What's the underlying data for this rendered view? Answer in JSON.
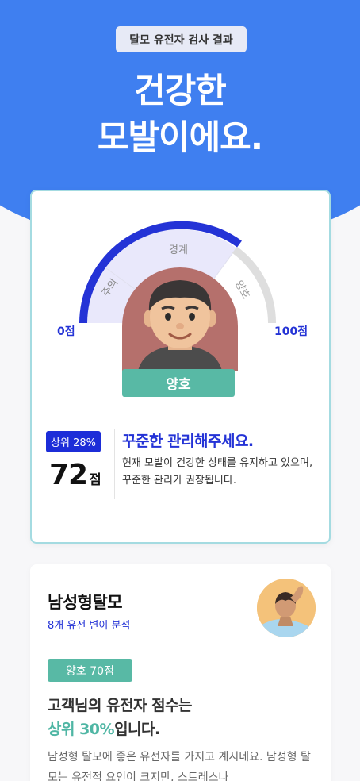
{
  "header": {
    "tag": "탈모 유전자 검사 결과",
    "title_line1": "건강한",
    "title_line2": "모발이에요."
  },
  "gauge": {
    "zones": [
      "주의",
      "경계",
      "양호"
    ],
    "min_label": "0점",
    "max_label": "100점",
    "score": 72,
    "status": "양호",
    "colors": {
      "fill": "#2433d6",
      "track": "#dedede",
      "zone_bg": "#e9e8fb"
    }
  },
  "result": {
    "rank_badge": "상위 28%",
    "score_value": "72",
    "score_unit": "점",
    "advice_title": "꾸준한 관리해주세요.",
    "advice_body": "현재 모발이 건강한 상태를 유지하고 있으며, 꾸준한 관리가 권장됩니다."
  },
  "male_pattern": {
    "title": "남성형탈모",
    "subtitle": "8개 유전 변이 분석",
    "status_pill": "양호 70점",
    "line1": "고객님의 유전자 점수는",
    "line2_accent": "상위 30%",
    "line2_rest": "입니다.",
    "body": "남성형 탈모에 좋은 유전자를 가지고 계시네요. 남성형 탈모는 유전적 요인이 크지만, 스트레스나"
  },
  "colors": {
    "brand_blue": "#3f7ff0",
    "accent_navy": "#2433d6",
    "teal": "#58b9a5"
  }
}
